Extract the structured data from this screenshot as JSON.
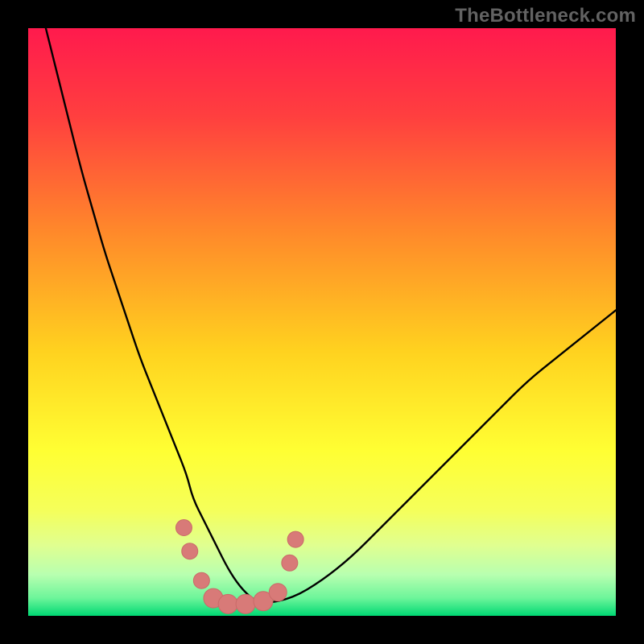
{
  "watermark": "TheBottleneck.com",
  "chart_data": {
    "type": "line",
    "title": "",
    "xlabel": "",
    "ylabel": "",
    "xlim": [
      0,
      100
    ],
    "ylim": [
      0,
      100
    ],
    "grid": false,
    "legend": false,
    "gradient_stops": [
      {
        "offset": 0.0,
        "color": "#ff1a4d"
      },
      {
        "offset": 0.15,
        "color": "#ff3f3f"
      },
      {
        "offset": 0.35,
        "color": "#ff8a2a"
      },
      {
        "offset": 0.55,
        "color": "#ffd21f"
      },
      {
        "offset": 0.72,
        "color": "#ffff33"
      },
      {
        "offset": 0.82,
        "color": "#f5ff5a"
      },
      {
        "offset": 0.88,
        "color": "#e0ff90"
      },
      {
        "offset": 0.93,
        "color": "#b8ffb0"
      },
      {
        "offset": 0.97,
        "color": "#6cf59a"
      },
      {
        "offset": 1.0,
        "color": "#00d873"
      }
    ],
    "series": [
      {
        "name": "bottleneck-curve",
        "stroke": "#000000",
        "stroke_width": 2.4,
        "x": [
          3,
          5,
          7,
          9,
          11,
          13,
          15,
          17,
          19,
          21,
          23,
          25,
          27,
          28,
          30,
          32,
          34,
          36,
          38,
          40,
          45,
          50,
          55,
          60,
          65,
          70,
          75,
          80,
          85,
          90,
          95,
          100
        ],
        "y": [
          100,
          92,
          84,
          76,
          69,
          62,
          56,
          50,
          44,
          39,
          34,
          29,
          24,
          20,
          16,
          12,
          8,
          5,
          3,
          2,
          3,
          6,
          10,
          15,
          20,
          25,
          30,
          35,
          40,
          44,
          48,
          52
        ]
      }
    ],
    "markers": [
      {
        "name": "marker-set",
        "color": "#d87a78",
        "stroke": "#c96a68",
        "points": [
          {
            "x": 26.5,
            "y": 15.0,
            "r": 10
          },
          {
            "x": 27.5,
            "y": 11.0,
            "r": 10
          },
          {
            "x": 29.5,
            "y": 6.0,
            "r": 10
          },
          {
            "x": 31.5,
            "y": 3.0,
            "r": 12
          },
          {
            "x": 34.0,
            "y": 2.0,
            "r": 12
          },
          {
            "x": 37.0,
            "y": 2.0,
            "r": 12
          },
          {
            "x": 40.0,
            "y": 2.5,
            "r": 12
          },
          {
            "x": 42.5,
            "y": 4.0,
            "r": 11
          },
          {
            "x": 44.5,
            "y": 9.0,
            "r": 10
          },
          {
            "x": 45.5,
            "y": 13.0,
            "r": 10
          }
        ]
      }
    ]
  }
}
